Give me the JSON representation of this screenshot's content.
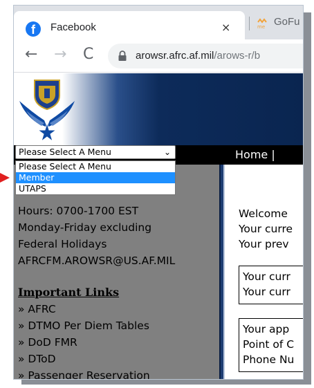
{
  "browser": {
    "tabs": [
      {
        "title": "Facebook",
        "icon": "facebook-icon",
        "active": true
      },
      {
        "title": "GoFu",
        "icon": "gofundme-icon",
        "active": false
      }
    ],
    "close_glyph": "×",
    "url_host": "arowsr.afrc.af.mil",
    "url_path": "/arows-r/b"
  },
  "navbar": {
    "home_label": "Home  |"
  },
  "menu_select": {
    "selected": "Please Select A Menu",
    "options": [
      "Please Select A Menu",
      "Member",
      "UTAPS"
    ],
    "highlighted": "Member"
  },
  "sidebar": {
    "contact_lines": [
      "Hours: 0700-1700 EST",
      "Monday-Friday excluding",
      "Federal Holidays",
      "AFRCFM.AROWSR@US.AF.MIL"
    ],
    "links_heading": "Important Links",
    "links": [
      "» AFRC",
      "» DTMO Per Diem Tables",
      "» DoD FMR",
      "» DToD",
      "» Passenger Reservation"
    ]
  },
  "content": {
    "intro_lines": [
      "Welcome",
      "Your curre",
      "Your prev"
    ],
    "box1_lines": [
      "Your curr",
      "Your curr"
    ],
    "box2_lines": [
      "Your app",
      "Point of C",
      "Phone Nu"
    ]
  },
  "colors": {
    "nav_bar": "#000000",
    "sidebar_bg": "#808080",
    "highlight": "#1e90ff",
    "header_blue": "#0d2b5a",
    "pointer_arrow": "#e02020"
  }
}
